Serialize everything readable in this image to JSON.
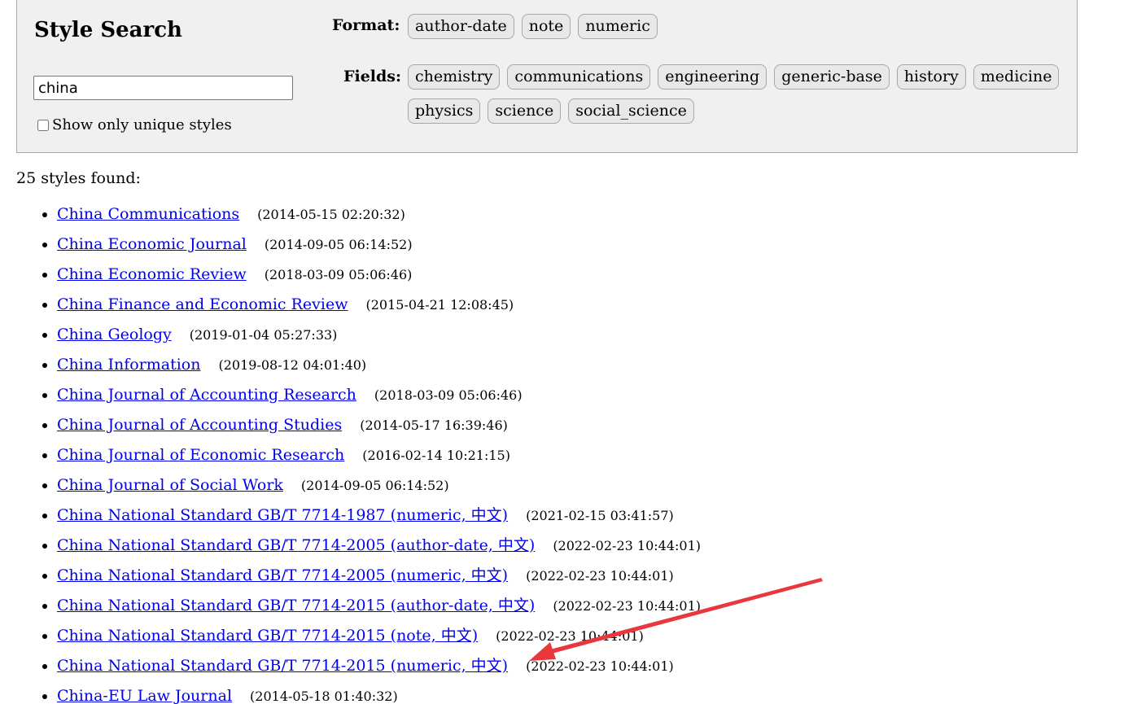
{
  "search": {
    "title": "Style Search",
    "query": "china",
    "unique_label": "Show only unique styles"
  },
  "facets": {
    "format_label": "Format:",
    "formats": [
      "author-date",
      "note",
      "numeric"
    ],
    "fields_label": "Fields:",
    "fields": [
      "chemistry",
      "communications",
      "engineering",
      "generic-base",
      "history",
      "medicine",
      "physics",
      "science",
      "social_science"
    ]
  },
  "results": {
    "count_text": "25 styles found:",
    "items": [
      {
        "title": "China Communications",
        "timestamp": "(2014-05-15 02:20:32)"
      },
      {
        "title": "China Economic Journal",
        "timestamp": "(2014-09-05 06:14:52)"
      },
      {
        "title": "China Economic Review",
        "timestamp": "(2018-03-09 05:06:46)"
      },
      {
        "title": "China Finance and Economic Review",
        "timestamp": "(2015-04-21 12:08:45)"
      },
      {
        "title": "China Geology",
        "timestamp": "(2019-01-04 05:27:33)"
      },
      {
        "title": "China Information",
        "timestamp": "(2019-08-12 04:01:40)"
      },
      {
        "title": "China Journal of Accounting Research",
        "timestamp": "(2018-03-09 05:06:46)"
      },
      {
        "title": "China Journal of Accounting Studies",
        "timestamp": "(2014-05-17 16:39:46)"
      },
      {
        "title": "China Journal of Economic Research",
        "timestamp": "(2016-02-14 10:21:15)"
      },
      {
        "title": "China Journal of Social Work",
        "timestamp": "(2014-09-05 06:14:52)"
      },
      {
        "title": "China National Standard GB/T 7714-1987 (numeric, 中文)",
        "timestamp": "(2021-02-15 03:41:57)"
      },
      {
        "title": "China National Standard GB/T 7714-2005 (author-date, 中文)",
        "timestamp": "(2022-02-23 10:44:01)"
      },
      {
        "title": "China National Standard GB/T 7714-2005 (numeric, 中文)",
        "timestamp": "(2022-02-23 10:44:01)"
      },
      {
        "title": "China National Standard GB/T 7714-2015 (author-date, 中文)",
        "timestamp": "(2022-02-23 10:44:01)"
      },
      {
        "title": "China National Standard GB/T 7714-2015 (note, 中文)",
        "timestamp": "(2022-02-23 10:44:01)"
      },
      {
        "title": "China National Standard GB/T 7714-2015 (numeric, 中文)",
        "timestamp": "(2022-02-23 10:44:01)"
      },
      {
        "title": "China-EU Law Journal",
        "timestamp": "(2014-05-18 01:40:32)"
      }
    ]
  },
  "annotation": {
    "arrow_color": "#e8383d"
  }
}
